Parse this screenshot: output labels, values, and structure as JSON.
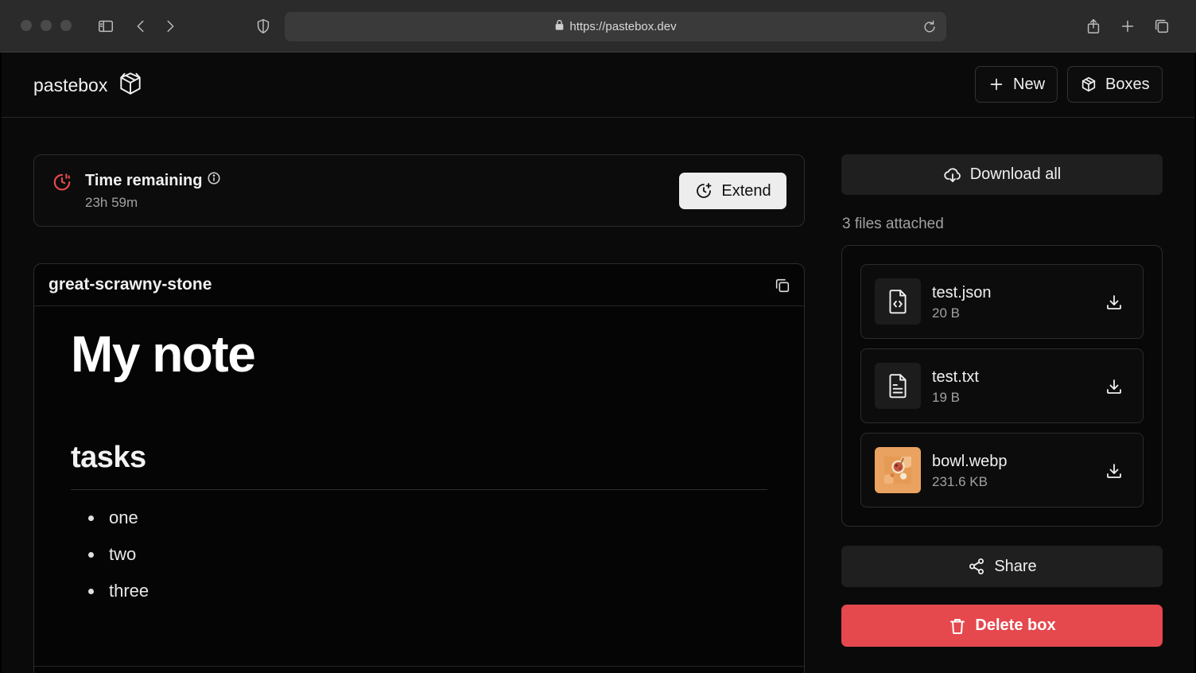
{
  "browser": {
    "url": "https://pastebox.dev",
    "icons": [
      "sidebar-icon",
      "back-icon",
      "forward-icon",
      "shield-icon",
      "lock-icon",
      "reload-icon",
      "share-icon",
      "plus-icon",
      "tabs-icon"
    ]
  },
  "header": {
    "brand": "pastebox",
    "new_label": "New",
    "boxes_label": "Boxes"
  },
  "timer": {
    "title": "Time remaining",
    "value": "23h 59m",
    "extend_label": "Extend",
    "accent": "#e5484d"
  },
  "note": {
    "name": "great-scrawny-stone",
    "heading": "My note",
    "subheading": "tasks",
    "items": [
      "one",
      "two",
      "three"
    ]
  },
  "files": {
    "download_all_label": "Download all",
    "count_text": "3 files attached",
    "list": [
      {
        "name": "test.json",
        "size": "20 B",
        "icon": "file-code-icon"
      },
      {
        "name": "test.txt",
        "size": "19 B",
        "icon": "file-text-icon"
      },
      {
        "name": "bowl.webp",
        "size": "231.6 KB",
        "icon": "image-thumbnail"
      }
    ]
  },
  "actions": {
    "share_label": "Share",
    "delete_label": "Delete box",
    "delete_color": "#e5484d"
  }
}
